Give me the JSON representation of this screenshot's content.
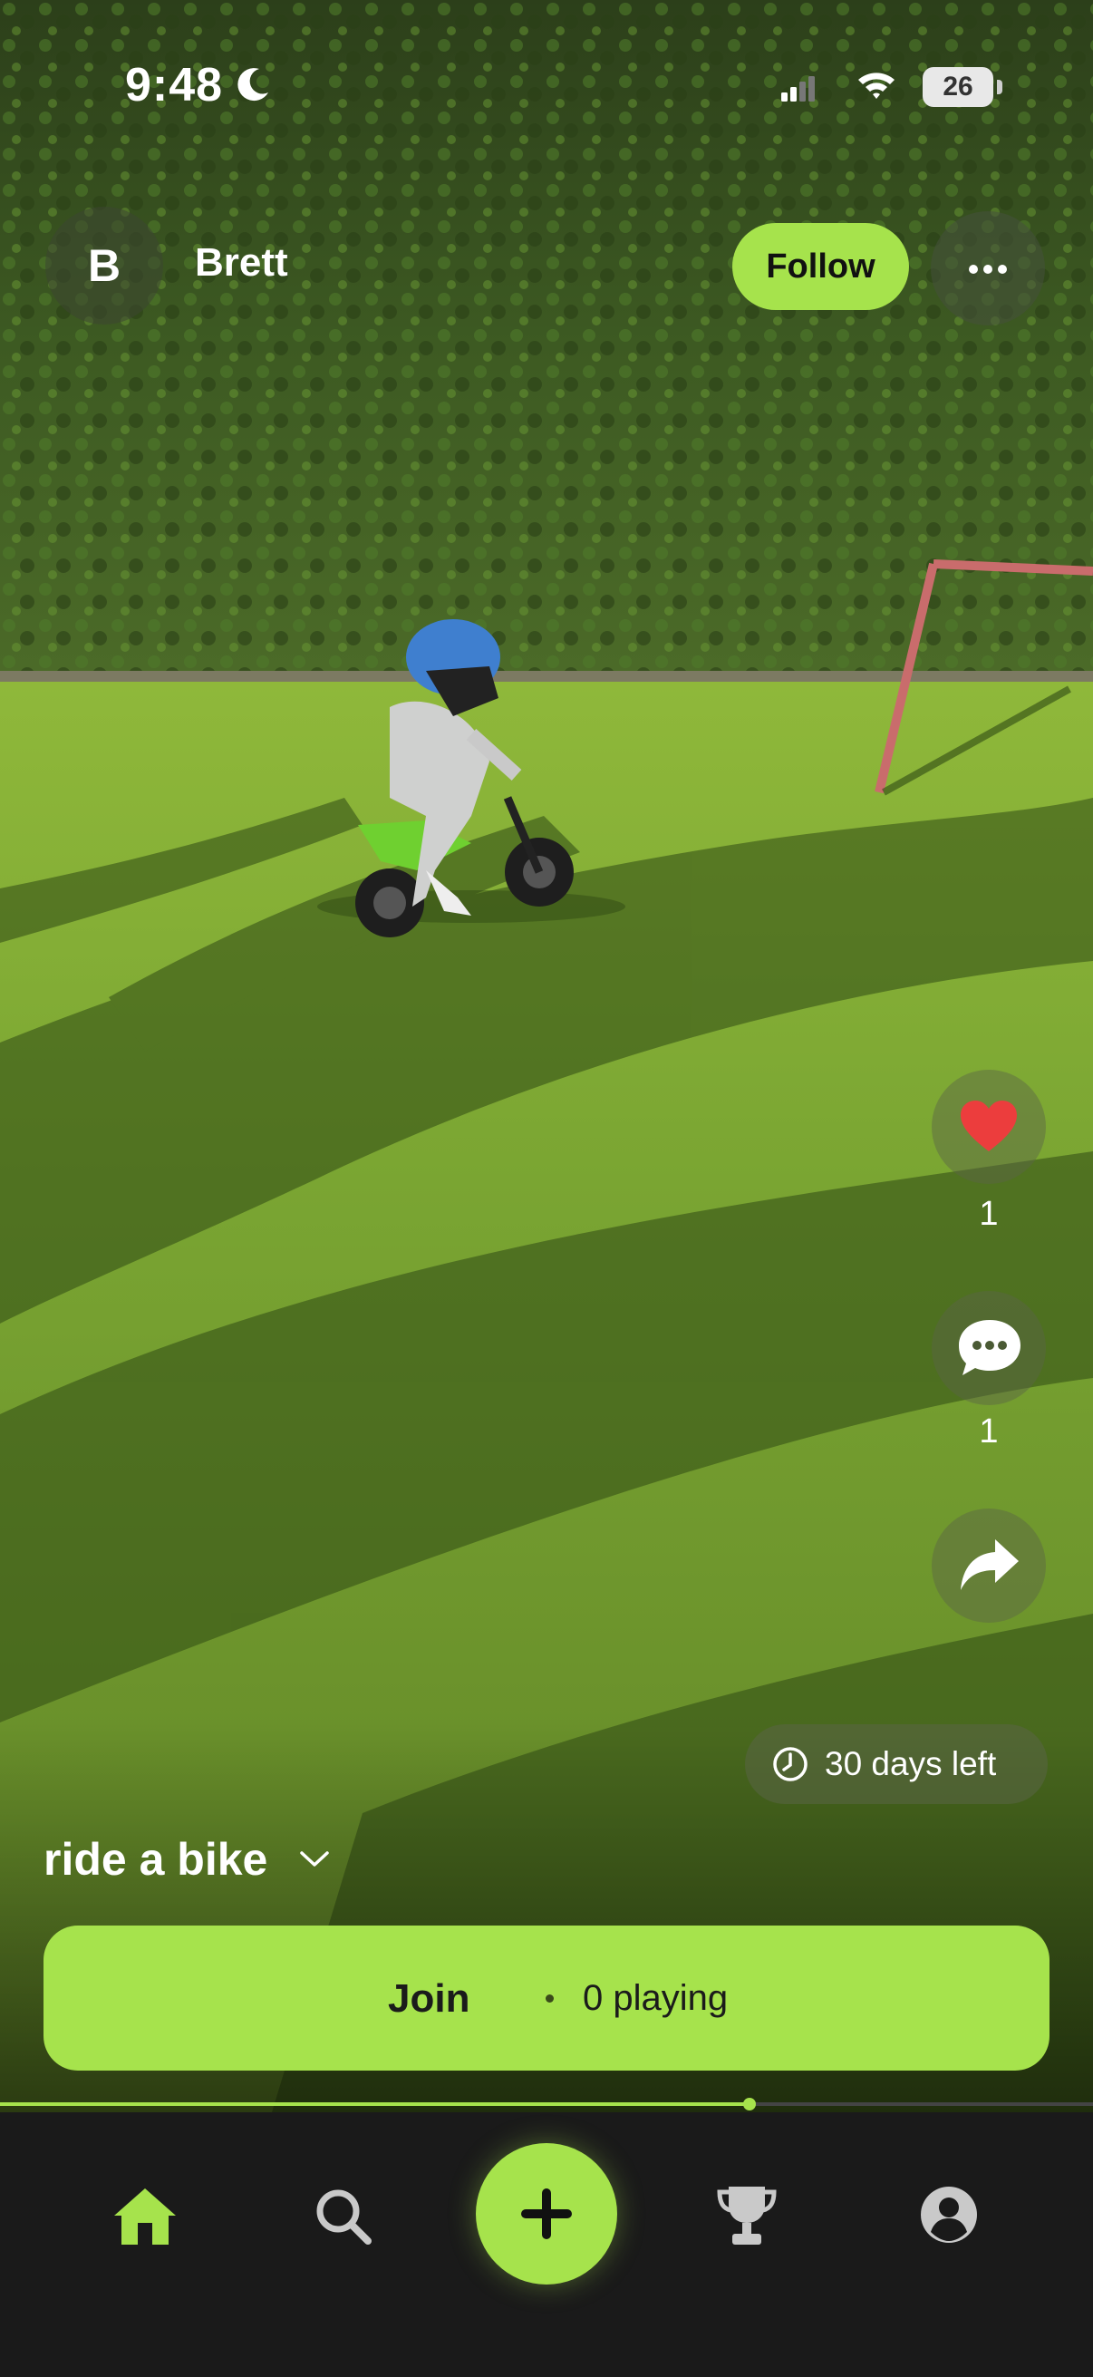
{
  "status_bar": {
    "time": "9:48",
    "battery": "26"
  },
  "header": {
    "avatar_initial": "B",
    "username": "Brett",
    "follow_label": "Follow"
  },
  "actions": {
    "likes": "1",
    "comments": "1"
  },
  "challenge": {
    "time_left": "30 days left",
    "title": "ride a bike"
  },
  "join": {
    "label": "Join",
    "playing": "0 playing"
  },
  "video_progress": 0.686,
  "colors": {
    "accent": "#a6e34c",
    "like": "#ec3d3d",
    "tabbar": "#1a1a1a",
    "inactive_icon": "#c9c9c9"
  },
  "tabs": [
    {
      "name": "home",
      "icon": "home-icon",
      "active": true
    },
    {
      "name": "search",
      "icon": "search-icon",
      "active": false
    },
    {
      "name": "create",
      "icon": "plus-icon",
      "active": false
    },
    {
      "name": "leaderboard",
      "icon": "trophy-icon",
      "active": false
    },
    {
      "name": "profile",
      "icon": "person-icon",
      "active": false
    }
  ]
}
